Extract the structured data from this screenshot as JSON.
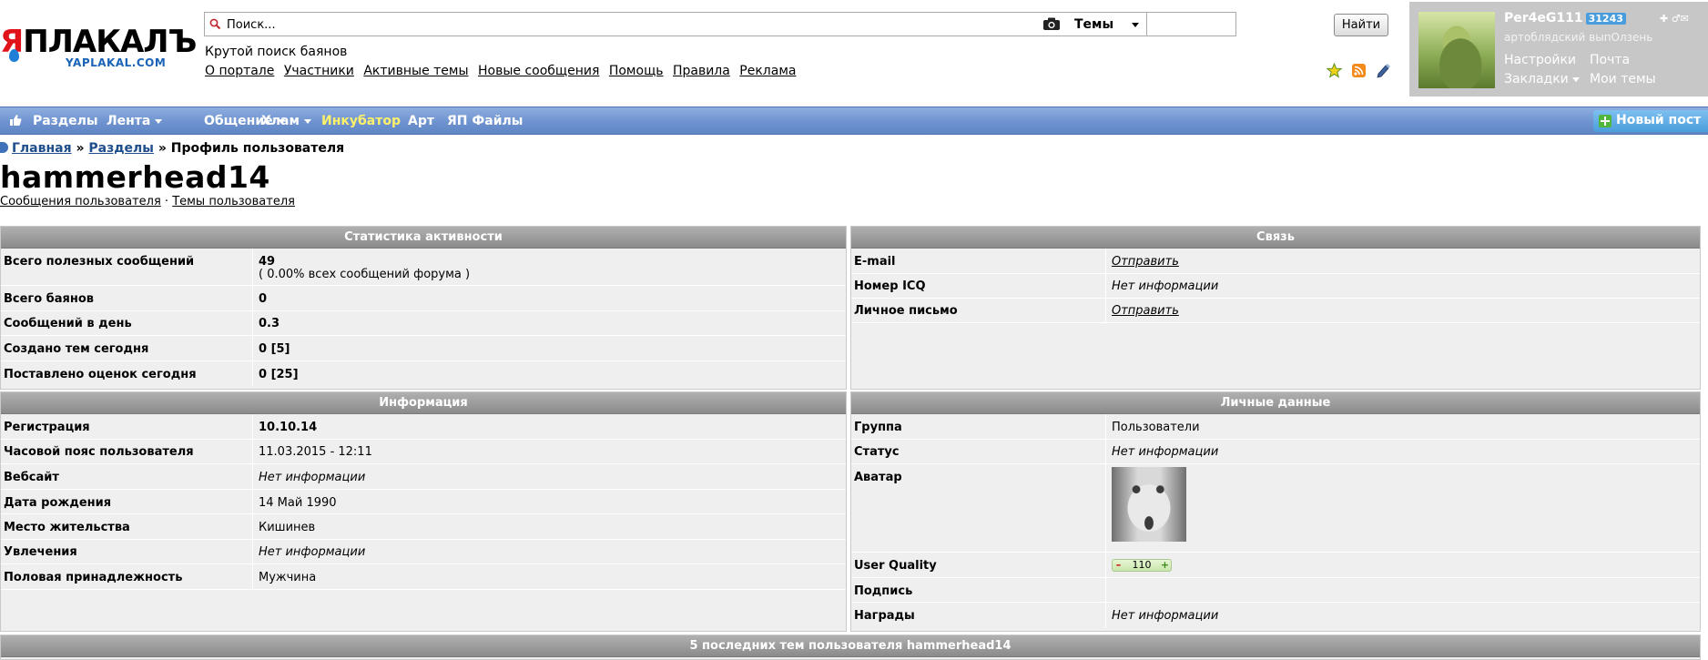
{
  "logo": {
    "text_red": "Я",
    "text_black": "ПЛАКАЛЪ",
    "site": "YAPLAKAL.COM"
  },
  "search": {
    "placeholder": "Поиск...",
    "scope": "Темы",
    "button": "Найти"
  },
  "header": {
    "tagline": "Крутой поиск баянов",
    "links": [
      "О портале",
      "Участники",
      "Активные темы",
      "Новые сообщения",
      "Помощь",
      "Правила",
      "Реклама"
    ],
    "icons": [
      "star-icon",
      "rss-icon",
      "pencil-icon"
    ]
  },
  "user": {
    "name": "Per4eG111",
    "score": "31243",
    "title": "артоблядский выпОлзень",
    "links": {
      "settings": "Настройки",
      "mail": "Почта",
      "bookmarks": "Закладки",
      "my_topics": "Мои темы"
    },
    "mini_icons": "✚ ♂✉"
  },
  "nav": {
    "items": [
      "Разделы",
      "Лента",
      "Общение",
      "Хлам",
      "Инкубатор",
      "Арт",
      "ЯП Файлы"
    ],
    "new_post": "Новый пост",
    "incubator_color": "#fff16a"
  },
  "breadcrumb": {
    "home": "Главная",
    "sep": "»",
    "sections": "Разделы",
    "current": "Профиль пользователя"
  },
  "profile": {
    "username": "hammerhead14",
    "posts_link": "Сообщения пользователя",
    "link_sep": "·",
    "topics_link": "Темы пользователя"
  },
  "activity": {
    "header": "Статистика активности",
    "rows": [
      {
        "label": "Всего полезных сообщений",
        "value": "49",
        "sub": "( 0.00% всех сообщений форума )"
      },
      {
        "label": "Всего баянов",
        "value": "0"
      },
      {
        "label": "Сообщений в день",
        "value": "0.3"
      },
      {
        "label": "Создано тем сегодня",
        "value": "0 [5]"
      },
      {
        "label": "Поставлено оценок сегодня",
        "value": "0 [25]"
      }
    ]
  },
  "contact": {
    "header": "Связь",
    "rows": [
      {
        "label": "E-mail",
        "value": "Отправить"
      },
      {
        "label": "Номер ICQ",
        "value": "Нет информации"
      },
      {
        "label": "Личное письмо",
        "value": "Отправить"
      }
    ]
  },
  "info": {
    "header": "Информация",
    "rows": [
      {
        "label": "Регистрация",
        "value": "10.10.14"
      },
      {
        "label": "Часовой пояс пользователя",
        "value": "11.03.2015 - 12:11"
      },
      {
        "label": "Вебсайт",
        "value": "Нет информации"
      },
      {
        "label": "Дата рождения",
        "value": "14 Май 1990"
      },
      {
        "label": "Место жительства",
        "value": "Кишинев"
      },
      {
        "label": "Увлечения",
        "value": "Нет информации"
      },
      {
        "label": "Половая принадлежность",
        "value": "Мужчина"
      }
    ]
  },
  "personal": {
    "header": "Личные данные",
    "rows": [
      {
        "label": "Группа",
        "value": "Пользователи"
      },
      {
        "label": "Статус",
        "value": "Нет информации"
      },
      {
        "label": "Аватар",
        "value": ""
      },
      {
        "label": "User Quality",
        "value": "110",
        "minus": "–",
        "plus": "+"
      },
      {
        "label": "Подпись",
        "value": ""
      },
      {
        "label": "Награды",
        "value": "Нет информации"
      }
    ]
  },
  "recent": {
    "header": "5 последних тем пользователя hammerhead14"
  }
}
